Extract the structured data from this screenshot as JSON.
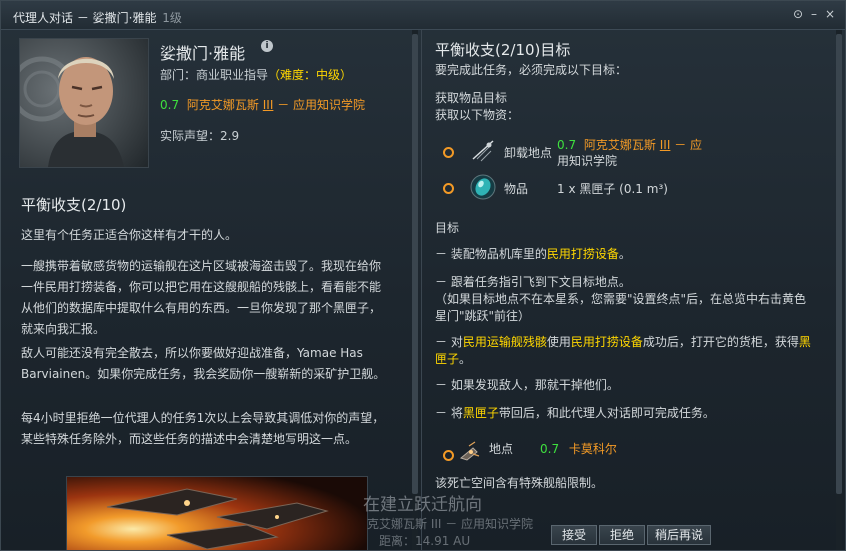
{
  "window": {
    "title": "代理人对话 － 娑撒门·雅能",
    "level": "1级",
    "btn_settings": "⊙",
    "btn_minimize": "–",
    "btn_close": "×"
  },
  "agent": {
    "name": "娑撒门·雅能",
    "info_icon": "i",
    "dept_prefix": "部门：商业职业指导",
    "difficulty": "（难度：中级）",
    "loc_sec": "0.7",
    "loc_system": "阿克艾娜瓦斯",
    "loc_planet": "III",
    "loc_station": "－ 应用知识学院",
    "standing": "实际声望：2.9"
  },
  "mission": {
    "title": "平衡收支(2/10)",
    "p1": "这里有个任务正适合你这样有才干的人。",
    "p2": "一艘携带着敏感货物的运输舰在这片区域被海盗击毁了。我现在给你一件民用打捞装备，你可以把它用在这艘舰船的残骸上，看看能不能从他们的数据库中提取什么有用的东西。一旦你发现了那个黑匣子，就来向我汇报。",
    "p3": "敌人可能还没有完全散去，所以你要做好迎战准备，Yamae Has Barviainen。如果你完成任务，我会奖励你一艘崭新的采矿护卫舰。",
    "p4": "每4小时里拒绝一位代理人的任务1次以上会导致其调低对你的声望，某些特殊任务除外，而这些任务的描述中会清楚地写明这一点。"
  },
  "objectives": {
    "title": "平衡收支(2/10)目标",
    "intro": "要完成此任务，必须完成以下目标：",
    "fetch_title": "获取物品目标",
    "fetch_sub": "获取以下物资：",
    "dropoff_label": "卸载地点",
    "dropoff_sec": "0.7",
    "dropoff_name1": "阿克艾娜瓦斯",
    "dropoff_planet": "III",
    "dropoff_name2": "－ 应",
    "dropoff_name3": "用知识学院",
    "item_label": "物品",
    "item_value": "1 x 黑匣子 (0.1 m³)",
    "goal_title": "目标",
    "o1_a": "－ 装配物品机库里的",
    "o1_hl": "民用打捞设备",
    "o1_b": "。",
    "o2_a": "－ 跟着任务指引飞到下文目标地点。",
    "o2_b": "（如果目标地点不在本星系，您需要\"设置终点\"后，在总览中右击黄色星门\"跳跃\"前往）",
    "o3_a": "－ 对",
    "o3_hl1": "民用运输舰残骸",
    "o3_b": "使用",
    "o3_hl2": "民用打捞设备",
    "o3_c": "成功后，打开它的货柜，获得",
    "o3_hl3": "黑匣子",
    "o3_d": "。",
    "o4": "－ 如果发现敌人，那就干掉他们。",
    "o5_a": "－ 将",
    "o5_hl": "黑匣子",
    "o5_b": "带回后，和此代理人对话即可完成任务。",
    "location_label": "地点",
    "location_sec": "0.7",
    "location_name": "卡莫科尔",
    "warning": "该死亡空间含有特殊舰船限制。"
  },
  "buttons": {
    "accept": "接受",
    "decline": "拒绝",
    "later": "稍后再说"
  },
  "overlay": {
    "line1": "在建立跃迁航向",
    "line2": "克艾娜瓦斯 III － 应用知识学院",
    "line3": "距离：14.91 AU"
  },
  "colors": {
    "highlight": "#ffd700",
    "security_green": "#3ee03e",
    "location_orange": "#f39a26",
    "warning_red": "#e3322a"
  }
}
